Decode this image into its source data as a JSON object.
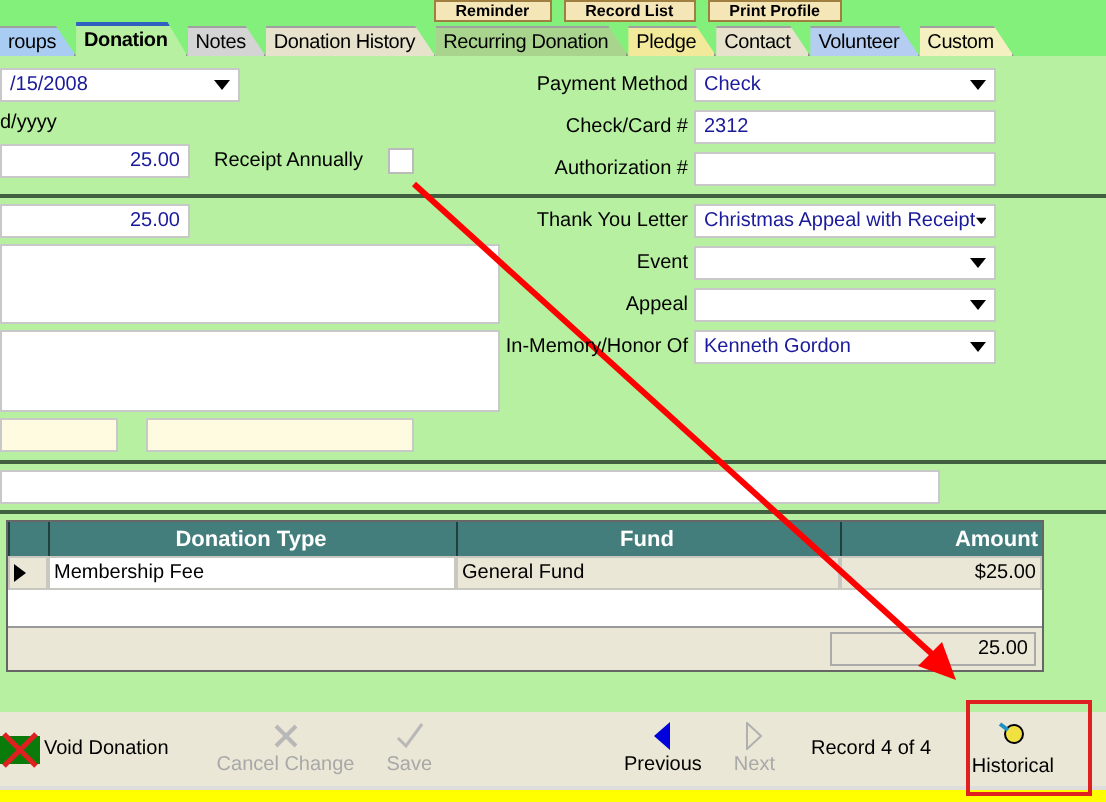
{
  "toolbar_top": [
    "Reminder",
    "Record List",
    "Print Profile"
  ],
  "tabs": [
    {
      "label": "roups",
      "selected": false,
      "color": "#a9cdf2"
    },
    {
      "label": "Donation",
      "selected": true,
      "color": "#b6f0a0"
    },
    {
      "label": "Notes",
      "selected": false,
      "color": "#d4d4d4"
    },
    {
      "label": "Donation History",
      "selected": false,
      "color": "#e6e2cc"
    },
    {
      "label": "Recurring Donation",
      "selected": false,
      "color": "#a8d48e"
    },
    {
      "label": "Pledge",
      "selected": false,
      "color": "#f2e99a"
    },
    {
      "label": "Contact",
      "selected": false,
      "color": "#e6e2cc"
    },
    {
      "label": "Volunteer",
      "selected": false,
      "color": "#b4cdf0"
    },
    {
      "label": "Custom",
      "selected": false,
      "color": "#f5f0c0"
    }
  ],
  "date": {
    "value": "/15/2008",
    "hint": "d/yyyy"
  },
  "amount": "25.00",
  "receipt_annually": {
    "label": "Receipt Annually",
    "checked": false
  },
  "right_top": [
    {
      "label": "Payment Method",
      "value": "Check",
      "kind": "dropdown"
    },
    {
      "label": "Check/Card #",
      "value": "2312",
      "kind": "text"
    },
    {
      "label": "Authorization #",
      "kind": "text"
    }
  ],
  "amount_2": "25.00",
  "right_mid": [
    {
      "label": "Thank You Letter",
      "value": "Christmas Appeal with Receipt",
      "kind": "dropdown"
    },
    {
      "label": "Event",
      "kind": "dropdown"
    },
    {
      "label": "Appeal",
      "kind": "dropdown"
    },
    {
      "label": "In-Memory/Honor Of",
      "value": "Kenneth Gordon",
      "kind": "dropdown"
    }
  ],
  "table": {
    "columns": [
      "Donation Type",
      "Fund",
      "Amount"
    ],
    "rows": [
      {
        "cells": [
          "Membership Fee",
          "General Fund",
          "$25.00"
        ],
        "selected": true
      }
    ],
    "total": "25.00"
  },
  "bottom_bar": {
    "buttons": [
      {
        "label": "Void Donation",
        "kind": "void",
        "disabled": false
      },
      {
        "label": "Cancel Change",
        "kind": "cancel",
        "disabled": true
      },
      {
        "label": "Save",
        "kind": "save",
        "disabled": true
      },
      {
        "label": "Previous",
        "kind": "previous",
        "disabled": false
      },
      {
        "label": "Next",
        "kind": "next",
        "disabled": true
      }
    ],
    "record": "Record 4 of 4",
    "historical": "Historical"
  }
}
